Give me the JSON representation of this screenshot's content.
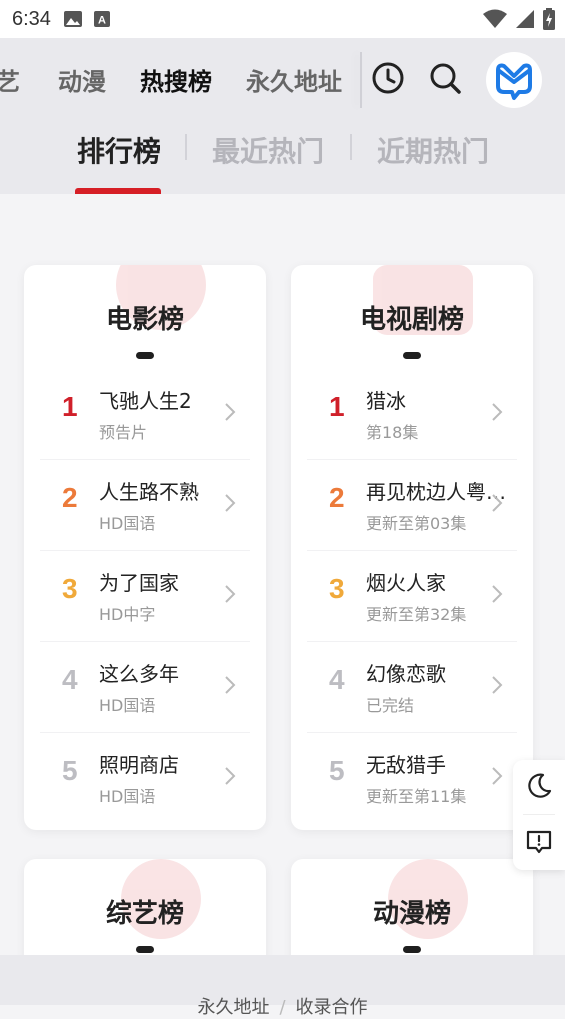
{
  "status_bar": {
    "time": "6:34"
  },
  "nav": {
    "items": [
      {
        "label": "艺"
      },
      {
        "label": "动漫"
      },
      {
        "label": "热搜榜"
      },
      {
        "label": "永久地址"
      }
    ],
    "active_index": 2
  },
  "subtabs": [
    {
      "label": "排行榜"
    },
    {
      "label": "最近热门"
    },
    {
      "label": "近期热门"
    }
  ],
  "cards": [
    {
      "title": "电影榜",
      "items": [
        {
          "rank": "1",
          "name": "飞驰人生2",
          "sub": "预告片"
        },
        {
          "rank": "2",
          "name": "人生路不熟",
          "sub": "HD国语"
        },
        {
          "rank": "3",
          "name": "为了国家",
          "sub": "HD中字"
        },
        {
          "rank": "4",
          "name": "这么多年",
          "sub": "HD国语"
        },
        {
          "rank": "5",
          "name": "照明商店",
          "sub": "HD国语"
        }
      ]
    },
    {
      "title": "电视剧榜",
      "items": [
        {
          "rank": "1",
          "name": "猎冰",
          "sub": "第18集"
        },
        {
          "rank": "2",
          "name": "再见枕边人粤…",
          "sub": "更新至第03集"
        },
        {
          "rank": "3",
          "name": "烟火人家",
          "sub": "更新至第32集"
        },
        {
          "rank": "4",
          "name": "幻像恋歌",
          "sub": "已完结"
        },
        {
          "rank": "5",
          "name": "无敌猎手",
          "sub": "更新至第11集"
        }
      ]
    },
    {
      "title": "综艺榜"
    },
    {
      "title": "动漫榜"
    }
  ],
  "footer": {
    "link1": "永久地址",
    "link2": "收录合作"
  },
  "colors": {
    "rank1": "#d0202a",
    "rank2": "#ec7a3a",
    "rank3": "#f0a93a",
    "rank_other": "#bdbdc2",
    "accent_underline": "#d61f26",
    "nav_highlight": "#f5c842",
    "logo_blue": "#1e7be6"
  },
  "icons": {
    "history": "clock-icon",
    "search": "search-icon",
    "logo": "app-logo-icon",
    "theme": "moon-icon",
    "feedback": "feedback-icon"
  }
}
